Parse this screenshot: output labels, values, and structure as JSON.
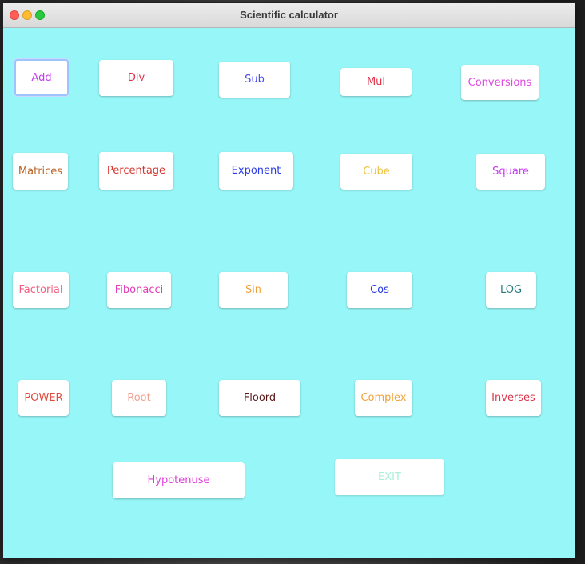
{
  "window": {
    "title": "Scientific calculator"
  },
  "buttons": {
    "add": {
      "label": "Add",
      "color": "#c23cf0"
    },
    "div": {
      "label": "Div",
      "color": "#e0344a"
    },
    "sub": {
      "label": "Sub",
      "color": "#4a4cf0"
    },
    "mul": {
      "label": "Mul",
      "color": "#e0344a"
    },
    "conversions": {
      "label": "Conversions",
      "color": "#e048e0"
    },
    "matrices": {
      "label": "Matrices",
      "color": "#b8672a"
    },
    "percentage": {
      "label": "Percentage",
      "color": "#d6342e"
    },
    "exponent": {
      "label": "Exponent",
      "color": "#2a3ae8"
    },
    "cube": {
      "label": "Cube",
      "color": "#f0c23a"
    },
    "square": {
      "label": "Square",
      "color": "#c83cf0"
    },
    "factorial": {
      "label": "Factorial",
      "color": "#f06080"
    },
    "fibonacci": {
      "label": "Fibonacci",
      "color": "#e03cb8"
    },
    "sin": {
      "label": "Sin",
      "color": "#f0a23a"
    },
    "cos": {
      "label": "Cos",
      "color": "#2a3ae8"
    },
    "log": {
      "label": "LOG",
      "color": "#2a7a7a"
    },
    "power": {
      "label": "POWER",
      "color": "#e04a3a"
    },
    "root": {
      "label": "Root",
      "color": "#f0a090"
    },
    "floord": {
      "label": "Floord",
      "color": "#5a1a1a"
    },
    "complex": {
      "label": "Complex",
      "color": "#f0a23a"
    },
    "inverses": {
      "label": "Inverses",
      "color": "#e0344a"
    },
    "hypotenuse": {
      "label": "Hypotenuse",
      "color": "#e03cd8"
    },
    "exit": {
      "label": "EXIT",
      "color": "#a8f0d8"
    }
  }
}
